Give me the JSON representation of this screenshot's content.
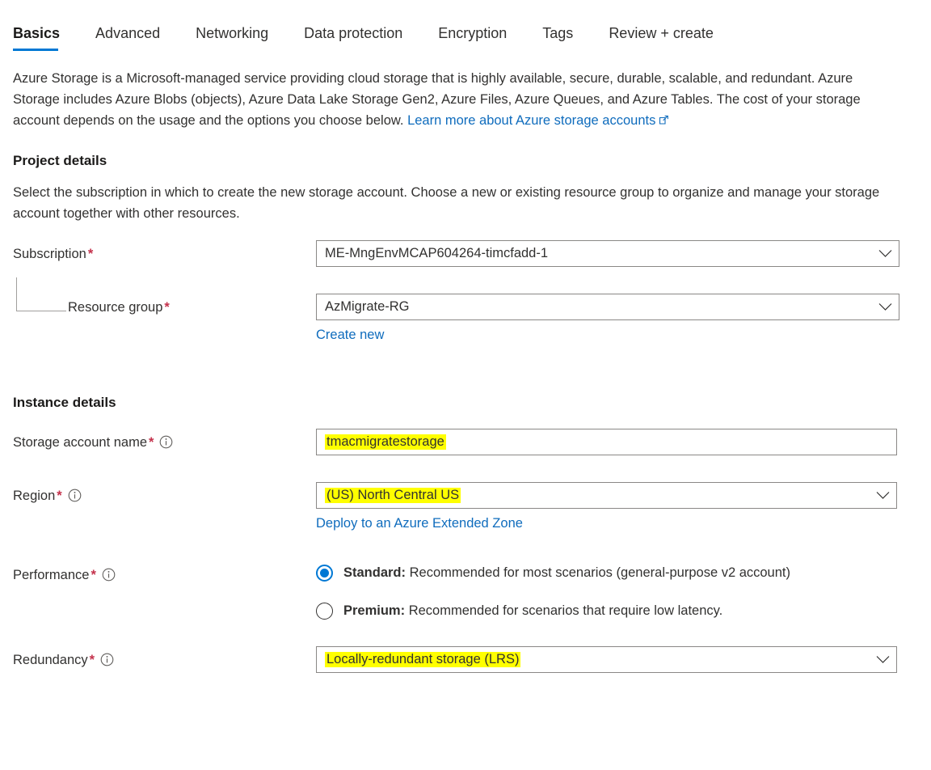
{
  "tabs": [
    {
      "label": "Basics",
      "active": true
    },
    {
      "label": "Advanced",
      "active": false
    },
    {
      "label": "Networking",
      "active": false
    },
    {
      "label": "Data protection",
      "active": false
    },
    {
      "label": "Encryption",
      "active": false
    },
    {
      "label": "Tags",
      "active": false
    },
    {
      "label": "Review + create",
      "active": false
    }
  ],
  "intro": {
    "body": "Azure Storage is a Microsoft-managed service providing cloud storage that is highly available, secure, durable, scalable, and redundant. Azure Storage includes Azure Blobs (objects), Azure Data Lake Storage Gen2, Azure Files, Azure Queues, and Azure Tables. The cost of your storage account depends on the usage and the options you choose below.",
    "link_text": "Learn more about Azure storage accounts",
    "link_icon": "external-link-icon"
  },
  "project_details": {
    "heading": "Project details",
    "description": "Select the subscription in which to create the new storage account. Choose a new or existing resource group to organize and manage your storage account together with other resources.",
    "subscription": {
      "label": "Subscription",
      "required": "*",
      "value": "ME-MngEnvMCAP604264-timcfadd-1",
      "icon": "chevron-down-icon"
    },
    "resource_group": {
      "label": "Resource group",
      "required": "*",
      "value": "AzMigrate-RG",
      "icon": "chevron-down-icon",
      "create_new_link": "Create new"
    }
  },
  "instance_details": {
    "heading": "Instance details",
    "storage_account_name": {
      "label": "Storage account name",
      "required": "*",
      "info_icon": "info-icon",
      "value": "tmacmigratestorage",
      "highlighted": true
    },
    "region": {
      "label": "Region",
      "required": "*",
      "info_icon": "info-icon",
      "value": "(US) North Central US",
      "highlighted": true,
      "icon": "chevron-down-icon",
      "sublink": "Deploy to an Azure Extended Zone"
    },
    "performance": {
      "label": "Performance",
      "required": "*",
      "info_icon": "info-icon",
      "options": [
        {
          "name": "Standard:",
          "description": " Recommended for most scenarios (general-purpose v2 account)",
          "selected": true
        },
        {
          "name": "Premium:",
          "description": " Recommended for scenarios that require low latency.",
          "selected": false
        }
      ]
    },
    "redundancy": {
      "label": "Redundancy",
      "required": "*",
      "info_icon": "info-icon",
      "value": "Locally-redundant storage (LRS)",
      "highlighted": true,
      "icon": "chevron-down-icon"
    }
  },
  "colors": {
    "accent": "#0078d4",
    "link": "#0f6cbd",
    "required_asterisk": "#c4314b",
    "highlight": "#ffff00",
    "border": "#8a8886",
    "text": "#323130"
  }
}
